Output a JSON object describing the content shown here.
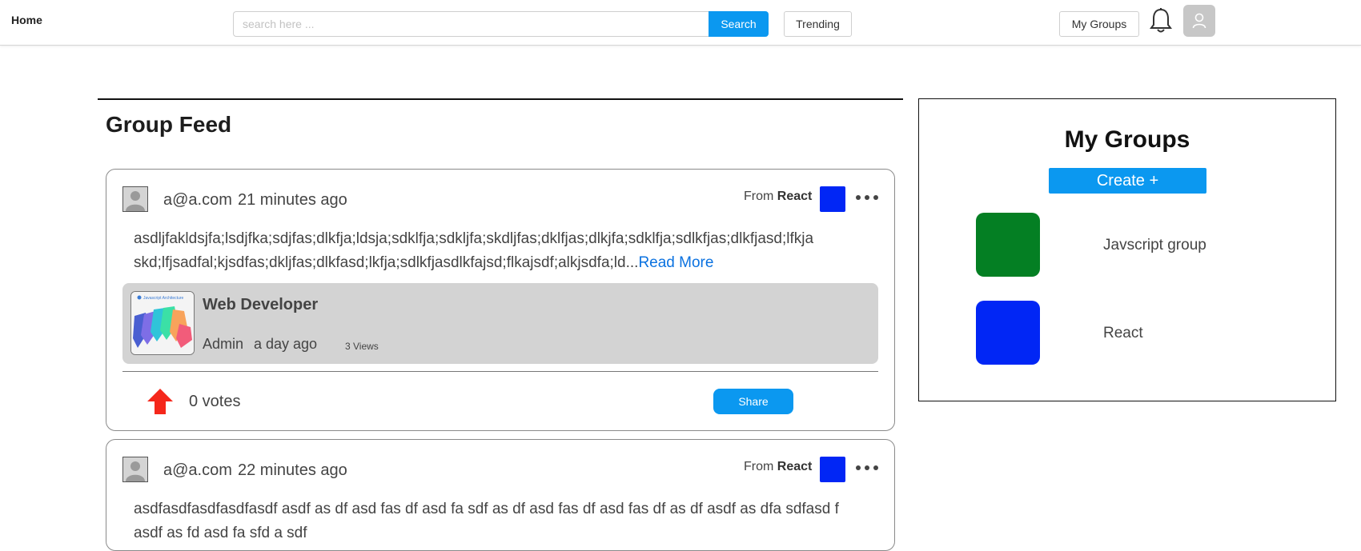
{
  "header": {
    "home": "Home",
    "search_placeholder": "search here ...",
    "search_button": "Search",
    "trending_button": "Trending",
    "my_groups_button": "My Groups"
  },
  "feed": {
    "title": "Group Feed",
    "posts": [
      {
        "author": "a@a.com",
        "time": "21 minutes ago",
        "from_label": "From",
        "group": "React",
        "group_color": "#0126f5",
        "text": "asdljfakldsjfa;lsdjfka;sdjfas;dlkfja;ldsja;sdklfja;sdkljfa;skdljfas;dklfjas;dlkjfa;sdklfja;sdlkfjas;dlkfjasd;lfkja skd;lfjsadfal;kjsdfas;dkljfas;dlkfasd;lkfja;sdlkfjasdlkfajsd;flkajsdf;alkjsdfa;ld...",
        "read_more": "Read More",
        "card": {
          "title": "Web Developer",
          "author": "Admin",
          "time": "a day ago",
          "views": "3 Views",
          "thumb_caption": "Javascript Architecture"
        },
        "votes": "0 votes",
        "share": "Share"
      },
      {
        "author": "a@a.com",
        "time": "22 minutes ago",
        "from_label": "From",
        "group": "React",
        "group_color": "#0126f5",
        "text": "asdfasdfasdfasdfasdf asdf as df asd fas df asd fa sdf as df asd fas df asd fas df as df asdf as dfa sdfasd f asdf as fd asd fa sfd a sdf"
      }
    ]
  },
  "my_groups": {
    "title": "My Groups",
    "create_button": "Create +",
    "groups": [
      {
        "name": "Javscript group",
        "color": "#047f23"
      },
      {
        "name": "React",
        "color": "#0126f5"
      }
    ]
  },
  "colors": {
    "accent": "#0b98f0",
    "upvote": "#f5271b",
    "card_bg": "#d3d3d3"
  }
}
